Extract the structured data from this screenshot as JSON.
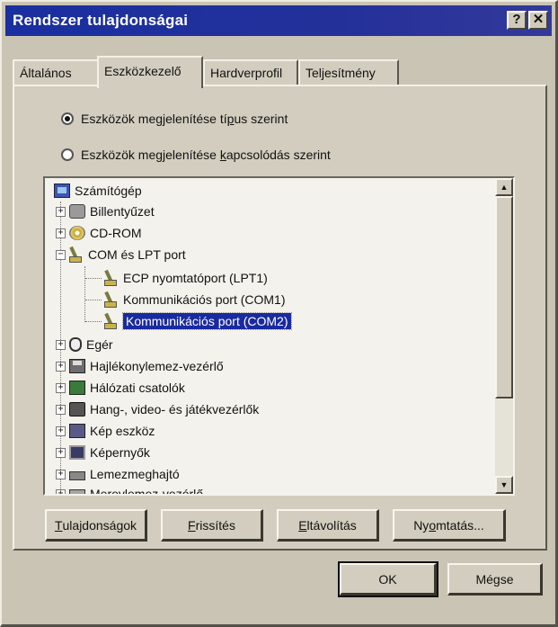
{
  "window": {
    "title": "Rendszer tulajdonságai",
    "help_label": "?",
    "close_label": "✕"
  },
  "tabs": [
    {
      "pre": "Általános",
      "u": "",
      "post": ""
    },
    {
      "pre": "Eszközkezelő",
      "u": "",
      "post": ""
    },
    {
      "pre": "Hardverprofil",
      "u": "",
      "post": ""
    },
    {
      "pre": "Teljesítmény",
      "u": "",
      "post": ""
    }
  ],
  "radios": {
    "by_type": {
      "pre": "Eszközök megjelenítése tí",
      "u": "p",
      "post": "us szerint",
      "checked": true
    },
    "by_connection": {
      "pre": "Eszközök megjelenítése ",
      "u": "k",
      "post": "apcsolódás szerint",
      "checked": false
    }
  },
  "tree": {
    "root": "Számítógép",
    "items": [
      {
        "label": "Billentyűzet",
        "icon": "keyboard-icon",
        "expander": "+"
      },
      {
        "label": "CD-ROM",
        "icon": "cd-icon",
        "expander": "+"
      },
      {
        "label": "COM és LPT port",
        "icon": "port-icon",
        "expander": "−"
      },
      {
        "label": "ECP nyomtatóport (LPT1)",
        "icon": "port-icon",
        "child": true
      },
      {
        "label": "Kommunikációs port (COM1)",
        "icon": "port-icon",
        "child": true
      },
      {
        "label": "Kommunikációs port (COM2)",
        "icon": "port-icon",
        "child": true,
        "selected": true
      },
      {
        "label": "Egér",
        "icon": "mouse-icon",
        "expander": "+"
      },
      {
        "label": "Hajlékonylemez-vezérlő",
        "icon": "floppy-icon",
        "expander": "+"
      },
      {
        "label": "Hálózati csatolók",
        "icon": "network-icon",
        "expander": "+"
      },
      {
        "label": "Hang-, video- és játékvezérlők",
        "icon": "sound-icon",
        "expander": "+"
      },
      {
        "label": "Kép eszköz",
        "icon": "image-icon",
        "expander": "+"
      },
      {
        "label": "Képernyők",
        "icon": "monitor-icon",
        "expander": "+"
      },
      {
        "label": "Lemezmeghajtó",
        "icon": "disk-icon",
        "expander": "+"
      },
      {
        "label": "Merevlemez-vezérlő",
        "icon": "hdd-icon",
        "expander": "+"
      }
    ]
  },
  "scroll": {
    "up": "▲",
    "down": "▼"
  },
  "buttons": {
    "properties": {
      "pre": "",
      "u": "T",
      "post": "ulajdonságok"
    },
    "refresh": {
      "pre": "",
      "u": "F",
      "post": "rissítés"
    },
    "remove": {
      "pre": "",
      "u": "E",
      "post": "ltávolítás"
    },
    "print": {
      "pre": "Ny",
      "u": "o",
      "post": "mtatás..."
    },
    "ok": "OK",
    "cancel": "Mégse"
  }
}
